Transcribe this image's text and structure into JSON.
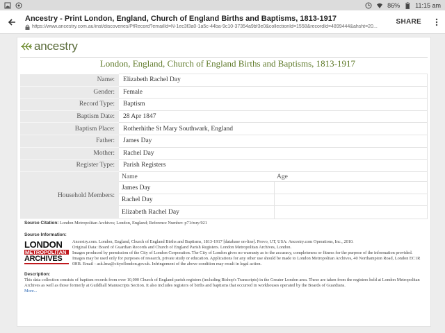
{
  "status_bar": {
    "battery": "86%",
    "time": "11:15 am"
  },
  "toolbar": {
    "title": "Ancestry - Print London, England, Church of England Births and Baptisms, 1813-1917",
    "url": "https://www.ancestry.com.au/inst/discoveries/PfRecord?emailId=N-1ec3f3a0-1a5c-44ba-9c10-37354a9bf3e0&collectionId=1558&recordId=4899444&ahsht=20...",
    "share_label": "SHARE"
  },
  "page": {
    "logo_text": "ancestry",
    "collection_title": "London, England, Church of England Births and Baptisms, 1813-1917",
    "fields": [
      {
        "label": "Name:",
        "value": "Elizabeth Rachel Day"
      },
      {
        "label": "Gender:",
        "value": "Female"
      },
      {
        "label": "Record Type:",
        "value": "Baptism"
      },
      {
        "label": "Baptism Date:",
        "value": "28 Apr 1847"
      },
      {
        "label": "Baptism Place:",
        "value": "Rotherhithe St Mary Southwark, England"
      },
      {
        "label": "Father:",
        "value": "James Day"
      },
      {
        "label": "Mother:",
        "value": "Rachel Day"
      },
      {
        "label": "Register Type:",
        "value": "Parish Registers"
      }
    ],
    "household": {
      "label": "Household Members:",
      "col_name": "Name",
      "col_age": "Age",
      "members": [
        {
          "name": "James Day",
          "age": ""
        },
        {
          "name": "Rachel Day",
          "age": ""
        },
        {
          "name": "Elizabeth Rachel Day",
          "age": ""
        }
      ]
    },
    "source_citation_label": "Source Citation:",
    "source_citation": "London Metropolitan Archives; London, England; Reference Number: p71/mry/021",
    "source_info_label": "Source Information:",
    "lma_logo": {
      "line1": "LONDON",
      "line2": "METROPOLITAN",
      "line3": "ARCHIVES"
    },
    "source_info_1": "Ancestry.com. London, England, Church of England Births and Baptisms, 1813-1917 [database on-line]. Provo, UT, USA: Ancestry.com Operations, Inc., 2010.",
    "source_info_2": "Original Data: Board of Guardian Records and Church of England Parish Registers. London Metropolitan Archives, London.",
    "source_info_3": "Images produced by permission of the City of London Corporation. The City of London gives no warranty as to the accuracy, completeness or fitness for the purpose of the information provided. Images may be used only for purposes of research, private study or education. Applications for any other use should be made to London Metropolitan Archives, 40 Northampton Road, London EC1R 0HB. Email - ask.lma@cityoflondon.gov.uk. Infringement of the above condition may result in legal action.",
    "description_label": "Description:",
    "description": "This data collection consists of baptism records from over 10,000 Church of England parish registers (including Bishop's Transcripts) in the Greater London area. These are taken from the registers held at London Metropolitan Archives as well as those formerly at Guildhall Manuscripts Section. It also includes registers of births and baptisms that occurred in workhouses operated by the Boards of Guardians.",
    "more_link": "More..."
  },
  "colors": {
    "ancestry_green": "#5f7a2a",
    "lma_red": "#c0181d",
    "link_blue": "#2a68b5"
  }
}
